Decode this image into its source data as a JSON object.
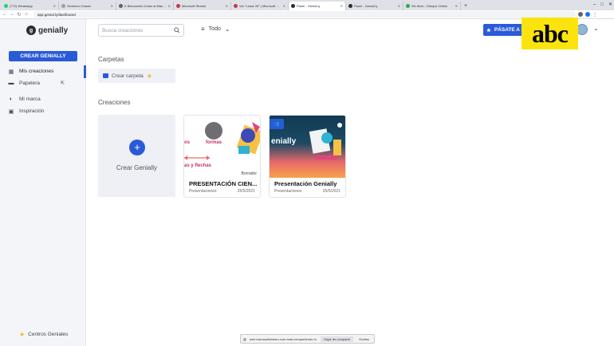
{
  "browser": {
    "tabs": [
      {
        "label": "(772) WhatsApp",
        "color": "#25d366",
        "active": false
      },
      {
        "label": "Sinónimo Clases",
        "color": "#9aa0a6",
        "active": false
      },
      {
        "label": "K Bienvenido Unión al Maestro...",
        "color": "#5f6368",
        "active": false
      },
      {
        "label": "Microsoft Stream",
        "color": "#c3394a",
        "active": false
      },
      {
        "label": "Ver \"Lunar 28\" | Microsoft Cl...",
        "color": "#c3394a",
        "active": false
      },
      {
        "label": "Panel - Genial.ly",
        "color": "#2b2b33",
        "active": true
      },
      {
        "label": "Panel - Genial.ly",
        "color": "#2b2b33",
        "active": false
      },
      {
        "label": "Sin título - Dibujos Online",
        "color": "#34a853",
        "active": false
      }
    ],
    "new_tab": "+",
    "url": "app.genial.ly/dashboard"
  },
  "sidebar": {
    "logo_text": "genially",
    "logo_glyph": "g",
    "create_button": "CREAR GENIALLY",
    "items": [
      {
        "label": "Mis creaciones",
        "icon": "grid-icon",
        "active": true
      },
      {
        "label": "Papelera",
        "icon": "trash-icon",
        "active": false
      },
      {
        "label": "Mi marca",
        "icon": "palette-icon",
        "active": false
      },
      {
        "label": "Inspiración",
        "icon": "inspiration-icon",
        "active": false
      }
    ],
    "footer": "Centros Geniales"
  },
  "topbar": {
    "search_placeholder": "Busca creaciones",
    "filter_label": "Todo",
    "premium_button": "PÁSATE A P"
  },
  "overlay": {
    "brand": "abc"
  },
  "content": {
    "folders_title": "Carpetas",
    "create_folder": "Crear carpeta",
    "creations_title": "Creaciones",
    "create_card_label": "Crear Genially",
    "cards": [
      {
        "title": "PRESENTACIÓN CIEN...",
        "type": "Presentaciones",
        "date": "25/5/2021",
        "badge": "Borrador",
        "thumb_texts": [
          "os",
          "formas",
          "as y flechas"
        ]
      },
      {
        "title": "Presentación Genially",
        "type": "Presentaciones",
        "date": "25/5/2021",
        "thumb_texts": [
          "enially"
        ]
      }
    ]
  },
  "sharebar": {
    "message": "web.microsoftstream.com está compartiendo tu pantalla.",
    "stop": "Dejar de compartir",
    "hide": "Ocultar"
  },
  "colors": {
    "accent": "#2a5bd7",
    "sidebar_bg": "#f4f5f9",
    "abc_yellow": "#fbe40d"
  }
}
